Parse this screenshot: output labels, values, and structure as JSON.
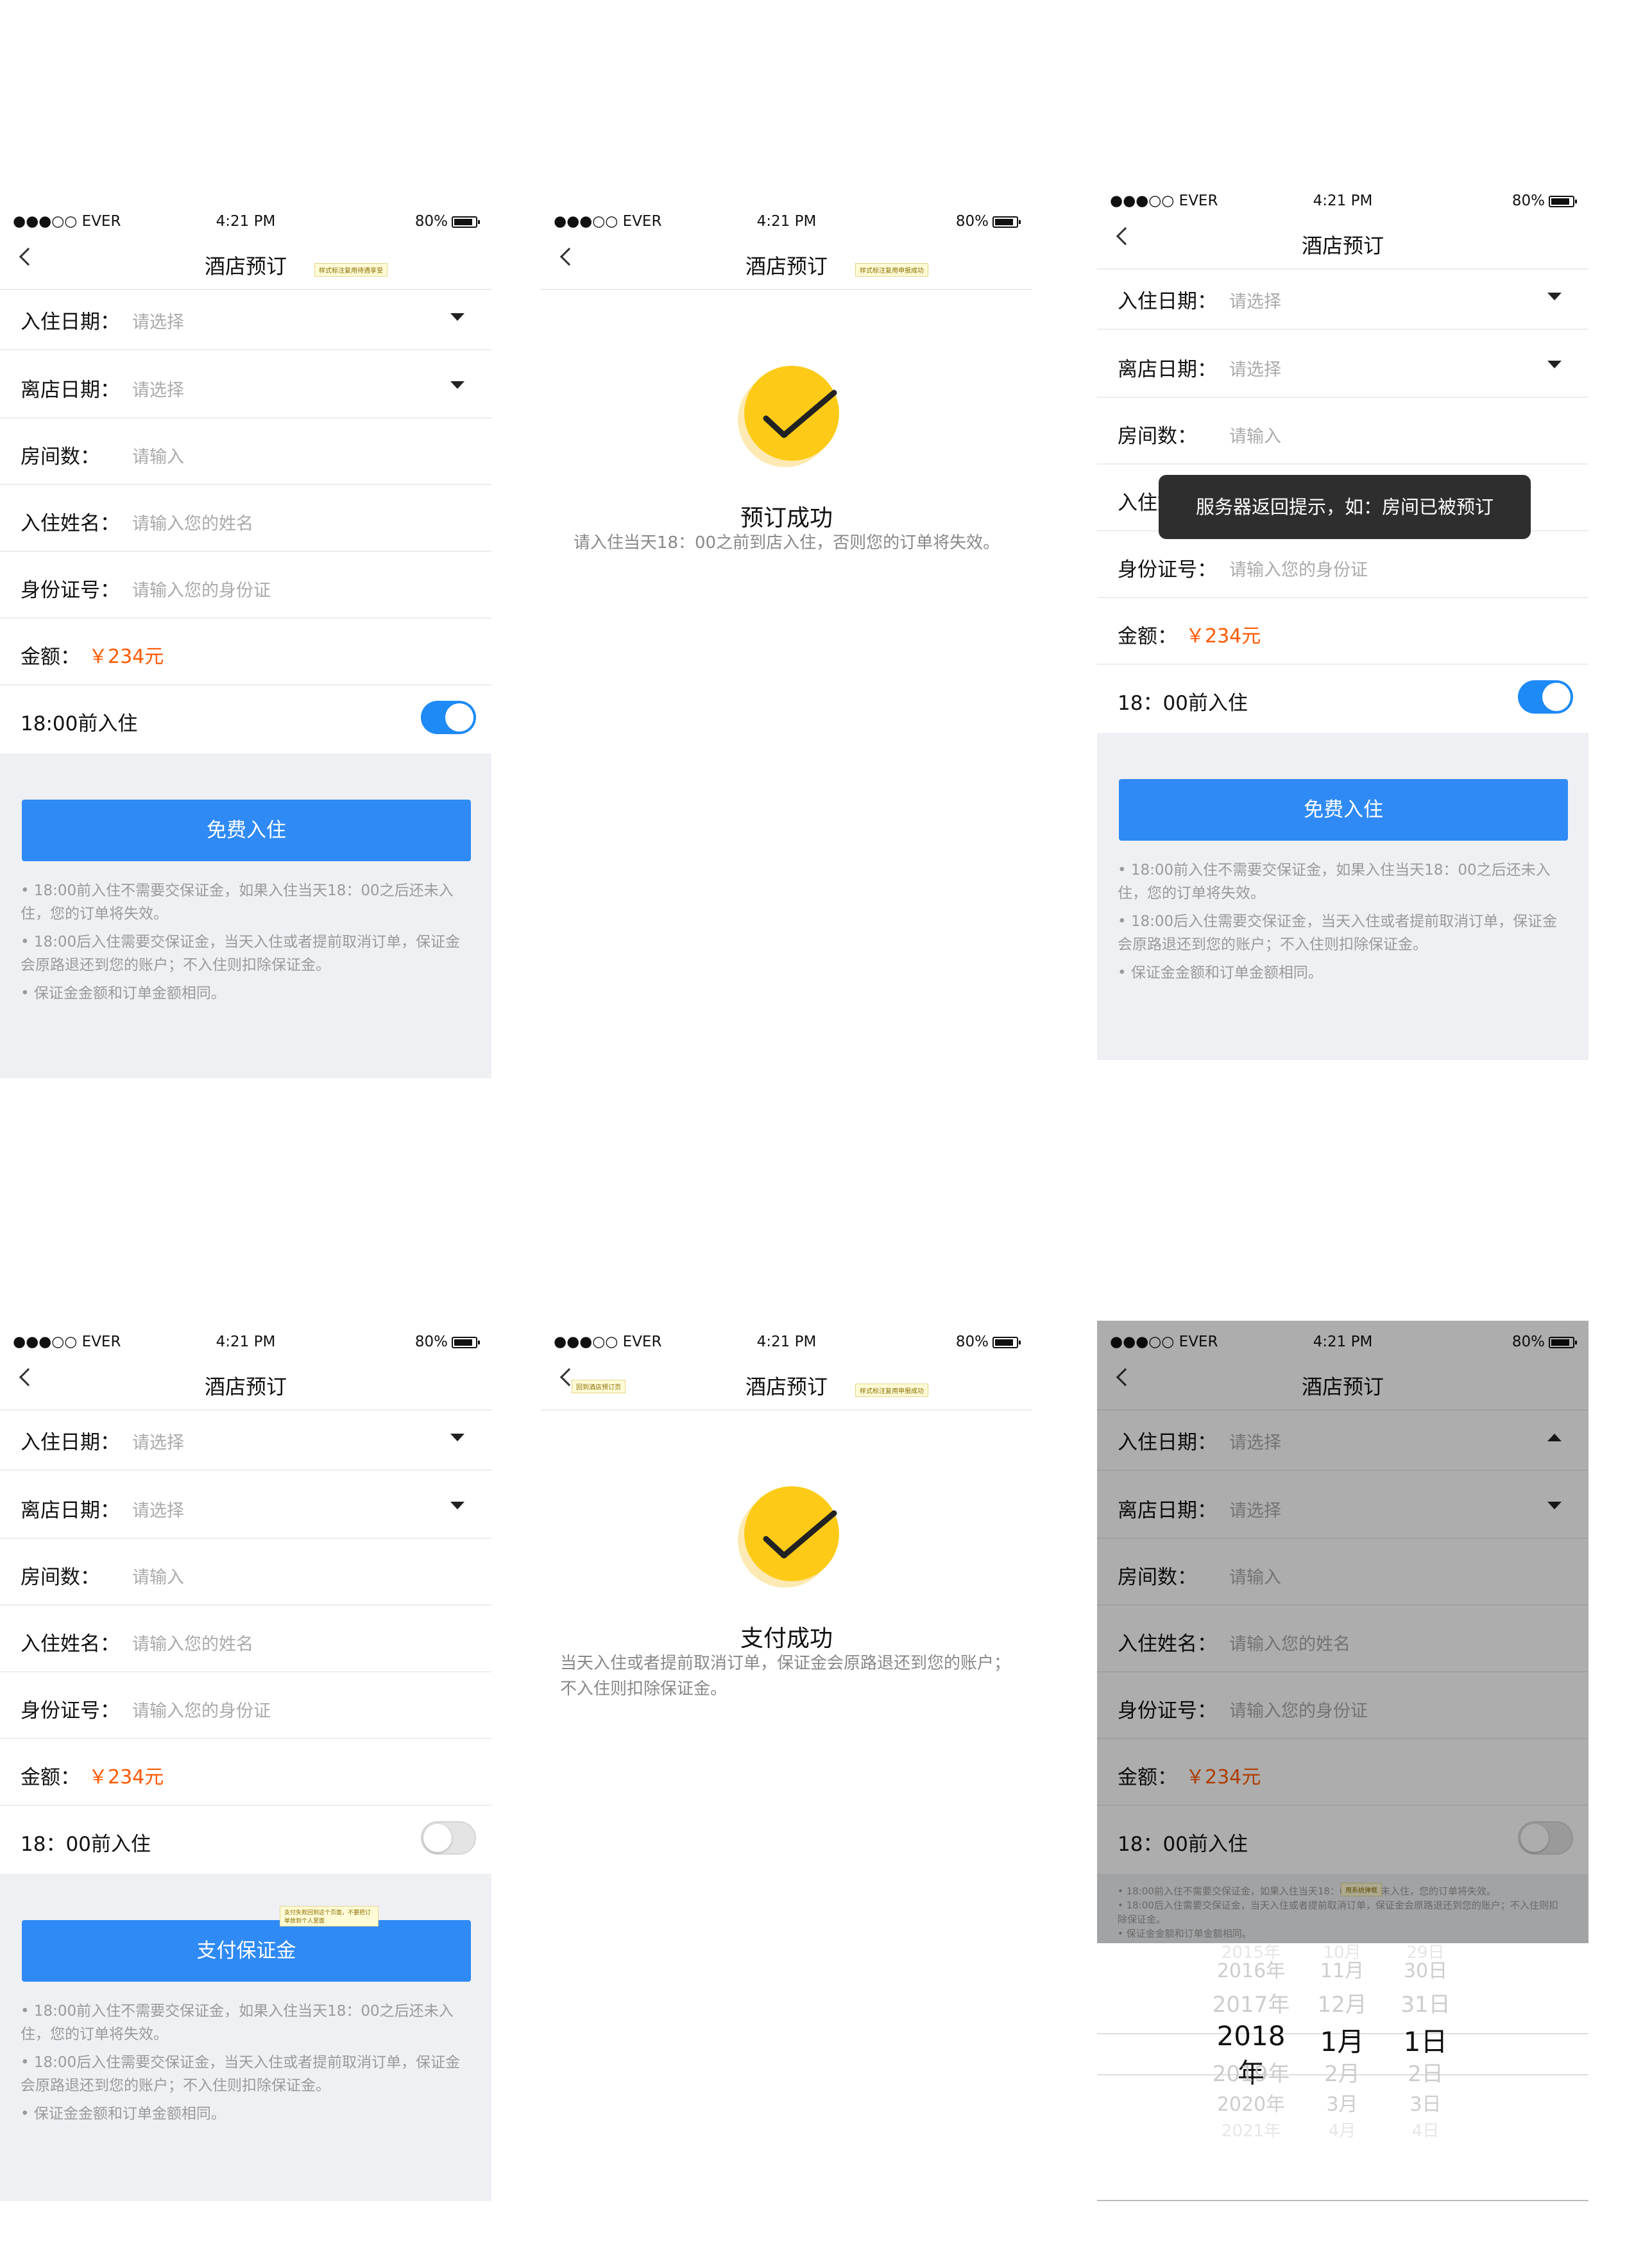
{
  "status": {
    "carrier": "●●●○○ EVER",
    "time": "4:21 PM",
    "battery": "80%"
  },
  "nav_title": "酒店预订",
  "form": {
    "checkin_label": "入住日期：",
    "checkout_label": "离店日期：",
    "select_ph": "请选择",
    "rooms_label": "房间数：",
    "input_ph": "请输入",
    "name_label": "入住姓名：",
    "name_ph": "请输入您的姓名",
    "id_label": "身份证号：",
    "id_ph": "请输入您的身份证",
    "amount_label": "金额：",
    "amount_value": "￥234元",
    "before18_a": "18:00前入住",
    "before18_b": "18：00前入住"
  },
  "buttons": {
    "free": "免费入住",
    "pay": "支付保证金"
  },
  "tips": [
    "• 18:00前入住不需要交保证金，如果入住当天18：00之后还未入住，您的订单将失效。",
    "• 18:00后入住需要交保证金，当天入住或者提前取消订单，保证金会原路退还到您的账户；不入住则扣除保证金。",
    "• 保证金金额和订单金额相同。"
  ],
  "success1": {
    "title": "预订成功",
    "desc": "请入住当天18：00之前到店入住，否则您的订单将失效。"
  },
  "success2": {
    "title": "支付成功",
    "desc": "当天入住或者提前取消订单，保证金会原路退还到您的账户；不入住则扣除保证金。"
  },
  "toast": "服务器返回提示，如：房间已被预订",
  "notes": {
    "s1_nav": "样式标注复用待遇享受",
    "s2_nav": "样式标注复用申报成功",
    "s5_back": "回到酒店预订页",
    "s5_nav": "样式标注复用申报成功",
    "s4_btn": "支付失败回到这个页面，不要把订单放到个人里面",
    "s6_tip": "用系统弹框"
  },
  "picker": {
    "years": [
      "2015年",
      "2016年",
      "2017年",
      "2018年",
      "2019年",
      "2020年",
      "2021年"
    ],
    "months": [
      "10月",
      "11月",
      "12月",
      "1月",
      "2月",
      "3月",
      "4月"
    ],
    "days": [
      "29日",
      "30日",
      "31日",
      "1日",
      "2日",
      "3日",
      "4日"
    ],
    "selected_index": 3
  },
  "colors": {
    "accent": "#2f8af5",
    "price": "#ff5a00",
    "success": "#fdcb17"
  }
}
